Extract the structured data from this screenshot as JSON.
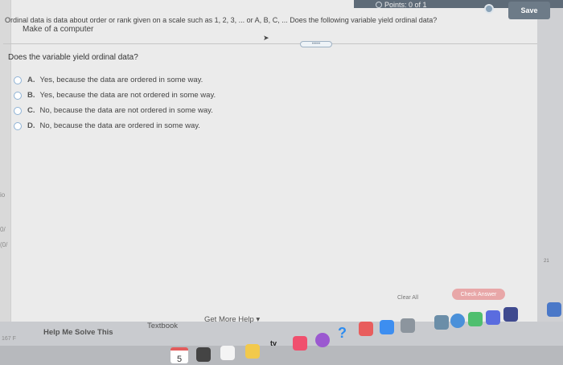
{
  "header": {
    "points_label": "Points: 0 of 1",
    "save_label": "Save"
  },
  "question": {
    "header_text": "Ordinal data is data about order or rank given on a scale such as 1, 2, 3, ... or A, B, C, ... Does the following variable yield ordinal data?",
    "item": "Make of a computer",
    "prompt": "Does the variable yield ordinal data?",
    "expand_label": "•••••"
  },
  "options": [
    {
      "letter": "A.",
      "text": "Yes, because the data are ordered in some way."
    },
    {
      "letter": "B.",
      "text": "Yes, because the data are not ordered in some way."
    },
    {
      "letter": "C.",
      "text": "No, because the data are not ordered in some way."
    },
    {
      "letter": "D.",
      "text": "No, because the data are ordered in some way."
    }
  ],
  "actions": {
    "clear_all": "Clear All",
    "check_answer": "Check Answer"
  },
  "footer": {
    "help_me_solve": "Help Me Solve This",
    "textbook": "Textbook",
    "get_more_help": "Get More Help ▾"
  },
  "side_scores": {
    "left_1": "io",
    "left_2": "0/",
    "left_3": "(0/",
    "left_bottom": "167 F",
    "right_num": "21"
  },
  "dock": {
    "calendar_day": "5",
    "tv_label": "tv"
  },
  "colors": {
    "topbar": "#5e6b78",
    "radio_border": "#8fb3d6",
    "check_answer": "#e8a7a8"
  }
}
